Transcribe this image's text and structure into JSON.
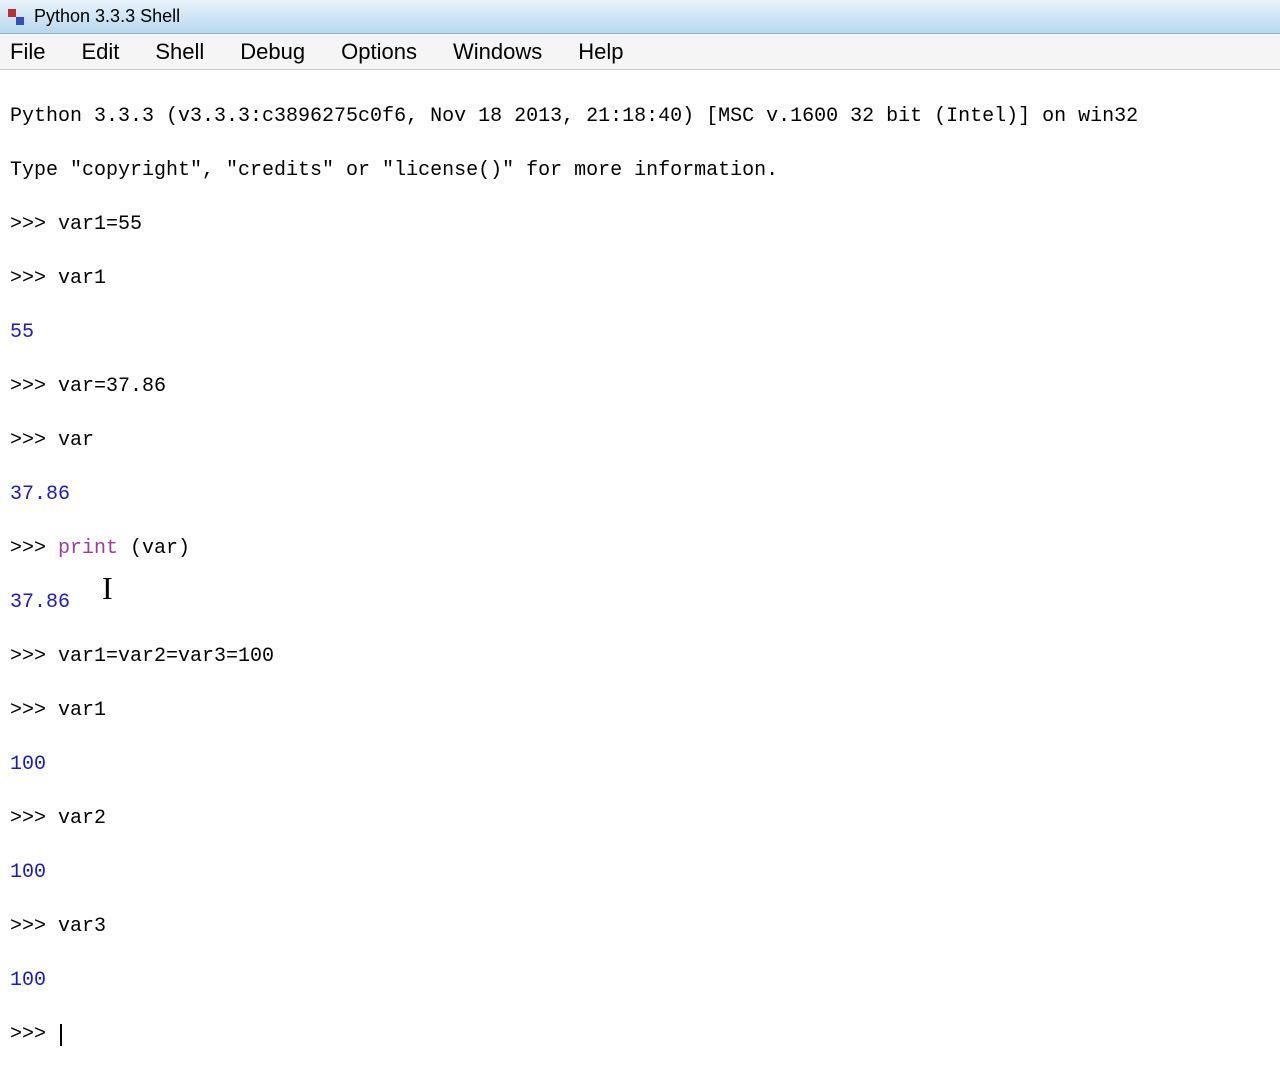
{
  "titlebar": {
    "title": "Python 3.3.3 Shell"
  },
  "menubar": {
    "items": [
      "File",
      "Edit",
      "Shell",
      "Debug",
      "Options",
      "Windows",
      "Help"
    ]
  },
  "terminal": {
    "banner1": "Python 3.3.3 (v3.3.3:c3896275c0f6, Nov 18 2013, 21:18:40) [MSC v.1600 32 bit (Intel)] on win32",
    "banner2": "Type \"copyright\", \"credits\" or \"license()\" for more information.",
    "prompt": ">>> ",
    "lines": {
      "l1": "var1=55",
      "l2": "var1",
      "o1": "55",
      "l3": "var=37.86",
      "l4": "var",
      "o2": "37.86",
      "l5_kw": "print",
      "l5_rest": " (var)",
      "o3": "37.86",
      "l6": "var1=var2=var3=100",
      "l7": "var1",
      "o4": "100",
      "l8": "var2",
      "o5": "100",
      "l9": "var3",
      "o6": "100"
    }
  }
}
